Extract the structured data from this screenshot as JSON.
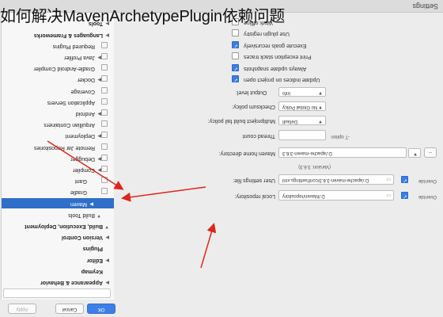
{
  "overlay_title": "如何解决MavenArchetypePlugin依赖问题",
  "window": {
    "title": "Settings"
  },
  "search": {
    "placeholder": ""
  },
  "sidebar": {
    "items": [
      {
        "label": "Appearance & Behavior",
        "bold": true,
        "arrow": "▶"
      },
      {
        "label": "Keymap",
        "bold": true,
        "arrow": ""
      },
      {
        "label": "Editor",
        "bold": true,
        "arrow": "▶"
      },
      {
        "label": "Plugins",
        "bold": true,
        "arrow": ""
      },
      {
        "label": "Version Control",
        "bold": true,
        "arrow": "▶"
      },
      {
        "label": "Build, Execution, Deployment",
        "bold": true,
        "arrow": "▼"
      },
      {
        "label": "Build Tools",
        "bold": false,
        "arrow": "▼"
      },
      {
        "label": "Maven",
        "bold": false,
        "arrow": "▶",
        "selected": true
      },
      {
        "label": "Gradle",
        "bold": false,
        "arrow": ""
      },
      {
        "label": "Gant",
        "bold": false,
        "arrow": ""
      },
      {
        "label": "Compiler",
        "bold": false,
        "arrow": "▶"
      },
      {
        "label": "Debugger",
        "bold": false,
        "arrow": "▶"
      },
      {
        "label": "Remote Jar Repositories",
        "bold": false,
        "arrow": ""
      },
      {
        "label": "Deployment",
        "bold": false,
        "arrow": "▶"
      },
      {
        "label": "Arquillian Containers",
        "bold": false,
        "arrow": ""
      },
      {
        "label": "Android",
        "bold": false,
        "arrow": "▶"
      },
      {
        "label": "Application Servers",
        "bold": false,
        "arrow": ""
      },
      {
        "label": "Coverage",
        "bold": false,
        "arrow": ""
      },
      {
        "label": "Docker",
        "bold": false,
        "arrow": "▶"
      },
      {
        "label": "Gradle-Android Compiler",
        "bold": false,
        "arrow": ""
      },
      {
        "label": "Java Profiler",
        "bold": false,
        "arrow": "▶"
      },
      {
        "label": "Required Plugins",
        "bold": false,
        "arrow": ""
      },
      {
        "label": "Languages & Frameworks",
        "bold": true,
        "arrow": "▶"
      },
      {
        "label": "Tools",
        "bold": true,
        "arrow": "▶"
      }
    ]
  },
  "checkboxes": [
    {
      "label": "Work offline",
      "checked": false
    },
    {
      "label": "Use plugin registry",
      "checked": false
    },
    {
      "label": "Execute goals recursively",
      "checked": true
    },
    {
      "label": "Print exception stack traces",
      "checked": false
    },
    {
      "label": "Always update snapshots",
      "checked": true
    },
    {
      "label": "Update indices on project open",
      "checked": true
    }
  ],
  "form": {
    "output_level_label": "Output level:",
    "output_level_value": "Info",
    "checksum_label": "Checksum policy:",
    "checksum_value": "No Global Policy",
    "multiproject_label": "Multiproject build fail policy:",
    "multiproject_value": "Default",
    "thread_count_label": "Thread count",
    "thread_count_hint": "-T option",
    "maven_home_label": "Maven home directory:",
    "maven_home_value": "D:/apache-maven-3.6.3",
    "maven_version": "(Version: 3.6.3)",
    "browse_label": "...",
    "user_settings_label": "User settings file:",
    "user_settings_value": "D:/apache-maven-3.6.3/conf/settings.xml",
    "local_repo_label": "Local repository:",
    "local_repo_value": "D:/Maven/repository",
    "override_label": "Override"
  },
  "buttons": {
    "ok": "OK",
    "cancel": "Cancel",
    "apply": "Apply"
  },
  "colors": {
    "selection": "#2f6fc9",
    "checkbox": "#3b7fe0",
    "arrow": "#e0261b"
  }
}
